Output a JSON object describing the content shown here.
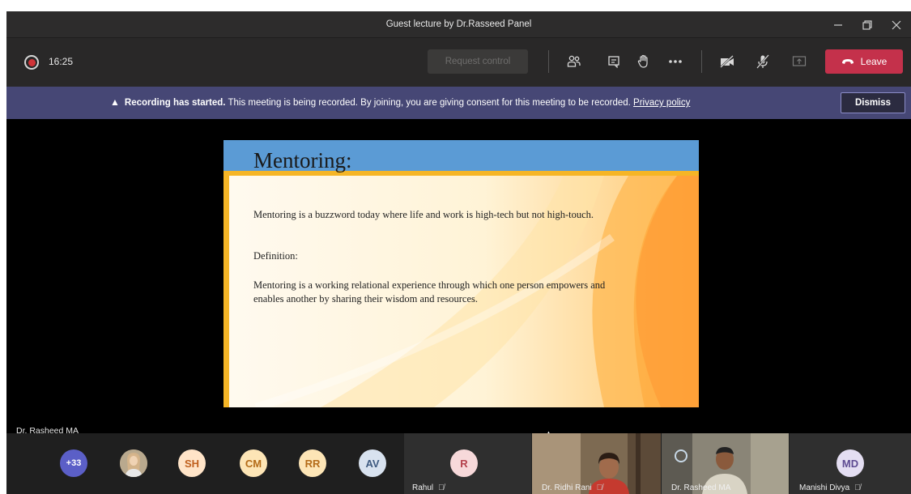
{
  "window": {
    "title": "Guest lecture by Dr.Rasseed Panel",
    "controls": [
      "minimize",
      "restore",
      "close"
    ]
  },
  "toolbar": {
    "timer": "16:25",
    "request_control_label": "Request control",
    "leave_label": "Leave",
    "icons": [
      "participants-icon",
      "chat-icon",
      "raise-hand-icon",
      "more-icon",
      "camera-off-icon",
      "mic-off-icon",
      "share-icon",
      "phone-icon"
    ]
  },
  "banner": {
    "bold_text": "Recording has started.",
    "text": " This meeting is being recorded. By joining, you are giving consent for this meeting to be recorded. ",
    "link_text": "Privacy policy",
    "dismiss_label": "Dismiss"
  },
  "slide": {
    "title": "Mentoring:",
    "line1": "Mentoring is a buzzword today where life and work is high-tech but not high-touch.",
    "definition_heading": "Definition:",
    "definition_line1": "Mentoring is a working relational experience through which one person empowers and",
    "definition_line2": "enables another by sharing their wisdom and resources."
  },
  "stage": {
    "speaker_name": "Dr. Rasheed MA"
  },
  "participants": {
    "overflow": "+33",
    "avatars": [
      {
        "initials": "SH",
        "color": "#ffe4c8",
        "text_color": "#c0601e"
      },
      {
        "initials": "CM",
        "color": "#fde5b6",
        "text_color": "#b46b18"
      },
      {
        "initials": "RR",
        "color": "#fde5b6",
        "text_color": "#b46b18"
      },
      {
        "initials": "AV",
        "color": "#d8e2ef",
        "text_color": "#3e5a80"
      }
    ],
    "tiles": [
      {
        "initials": "R",
        "name": "Rahul"
      },
      {
        "name": "Dr. Ridhi Rani"
      },
      {
        "name": "Dr. Rasheed MA"
      },
      {
        "initials": "MD",
        "name": "Manishi Divya"
      }
    ]
  },
  "colors": {
    "banner": "#464775",
    "leave": "#c4314b",
    "overflow_avatar": "#5b5fc7",
    "slide_header": "#5b9bd5",
    "slide_accent": "#f5b526"
  }
}
